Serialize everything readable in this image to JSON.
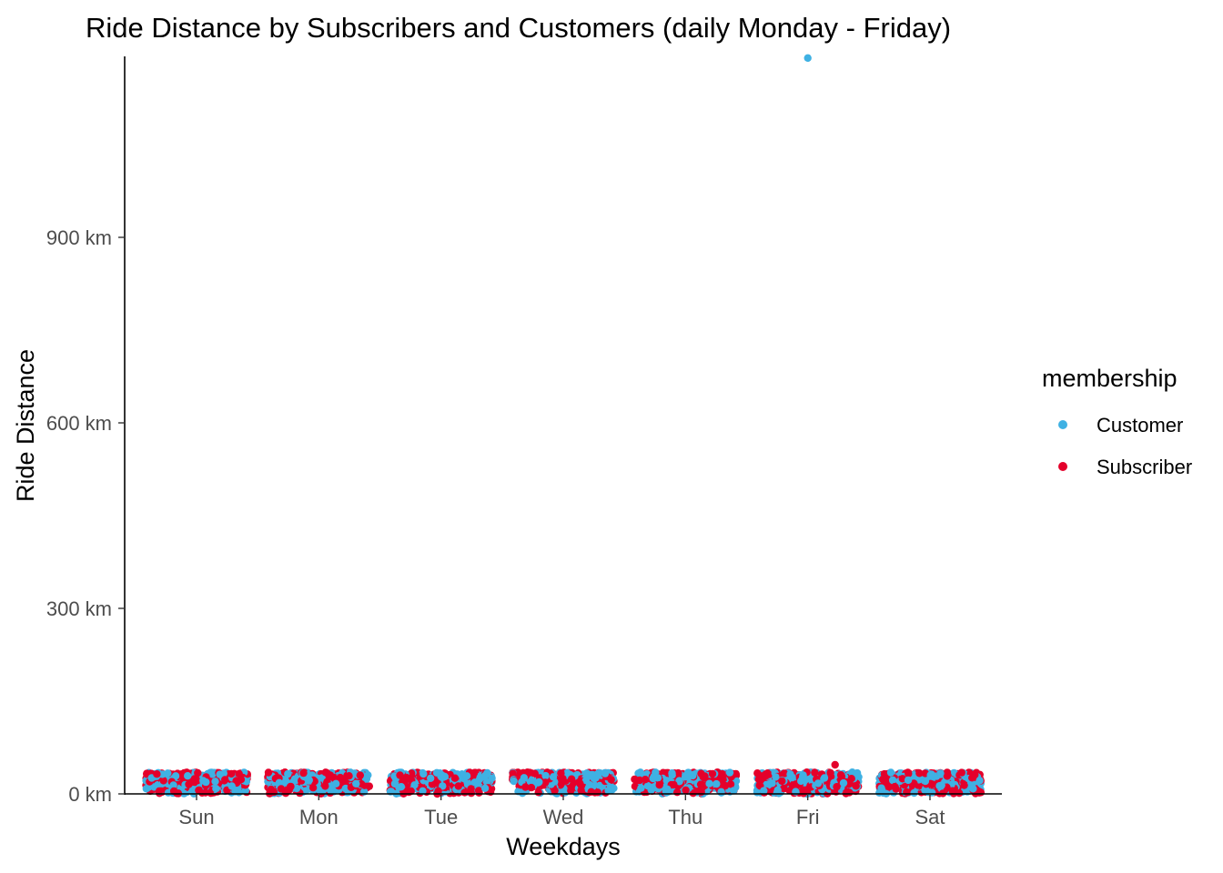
{
  "chart_data": {
    "type": "scatter",
    "title": "Ride Distance by Subscribers and Customers (daily Monday - Friday)",
    "xlabel": "Weekdays",
    "ylabel": "Ride Distance",
    "categories": [
      "Sun",
      "Mon",
      "Tue",
      "Wed",
      "Thu",
      "Fri",
      "Sat"
    ],
    "yticks": [
      {
        "value": 0,
        "label": "0 km"
      },
      {
        "value": 300,
        "label": "300 km"
      },
      {
        "value": 600,
        "label": "600 km"
      },
      {
        "value": 900,
        "label": "900 km"
      }
    ],
    "ylim": [
      0,
      1195
    ],
    "grid": false,
    "legend": {
      "title": "membership",
      "position": "right",
      "entries": [
        {
          "name": "Customer",
          "color": "#3FB1E3"
        },
        {
          "name": "Subscriber",
          "color": "#E4002B"
        }
      ]
    },
    "series": [
      {
        "name": "Customer",
        "color": "#3FB1E3",
        "typical_range_km": [
          0,
          35
        ],
        "outliers": [
          {
            "x": "Fri",
            "y": 1190
          }
        ]
      },
      {
        "name": "Subscriber",
        "color": "#E4002B",
        "typical_range_km": [
          0,
          35
        ],
        "outliers": [
          {
            "x": "Fri",
            "y": 47
          }
        ]
      }
    ]
  }
}
